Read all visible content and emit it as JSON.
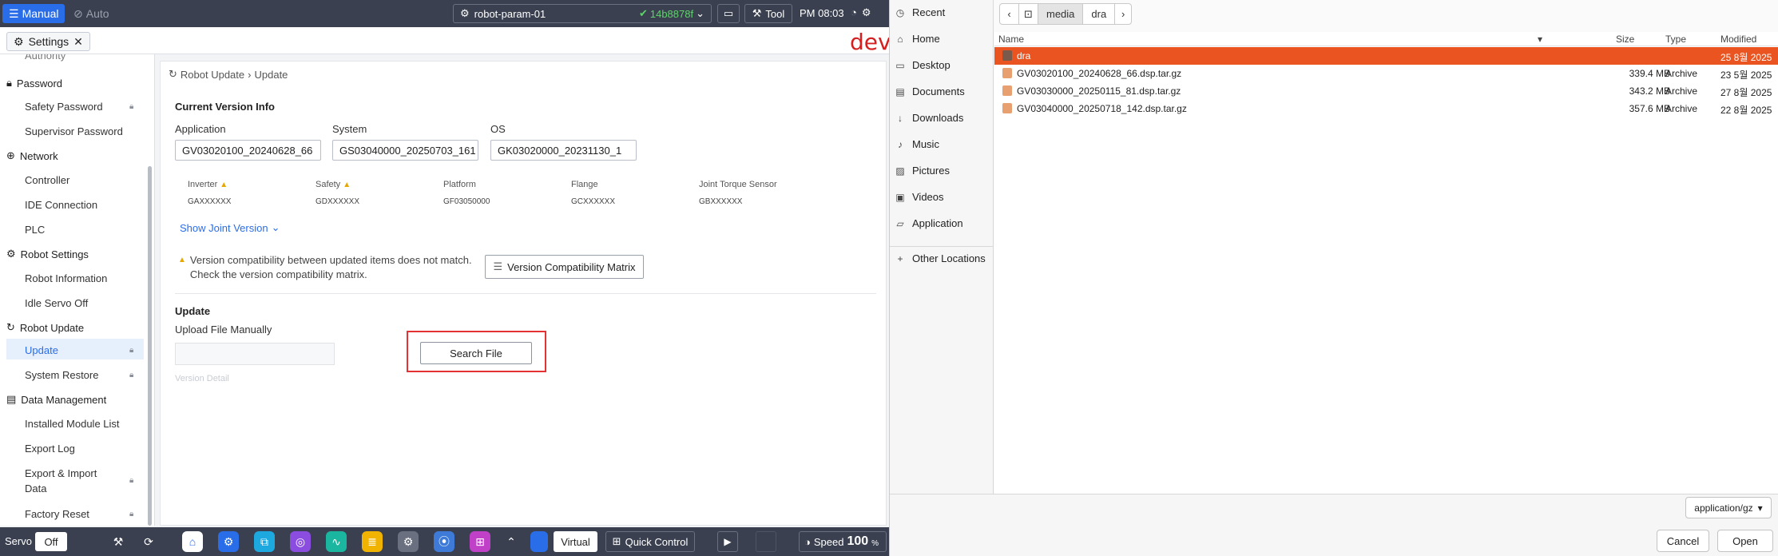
{
  "topbar": {
    "mode_manual": "Manual",
    "mode_auto": "Auto",
    "robot_name": "robot-param-01",
    "commit_hash": "14b8878f",
    "tool_label": "Tool",
    "clock": "PM 08:03"
  },
  "tabbar": {
    "settings_tab": "Settings",
    "dev_mark": "dev"
  },
  "sidebar": {
    "authority_partial": "Authority",
    "password": "Password",
    "safety_password": "Safety Password",
    "supervisor_password": "Supervisor Password",
    "network": "Network",
    "controller": "Controller",
    "ide_connection": "IDE Connection",
    "plc": "PLC",
    "robot_settings": "Robot Settings",
    "robot_information": "Robot Information",
    "idle_servo_off": "Idle Servo Off",
    "robot_update": "Robot Update",
    "update": "Update",
    "system_restore": "System Restore",
    "data_management": "Data Management",
    "installed_module_list": "Installed Module List",
    "export_log": "Export Log",
    "export_import_1": "Export & Import",
    "export_import_2": "Data",
    "factory_reset": "Factory Reset"
  },
  "content": {
    "breadcrumb_parent": "Robot Update",
    "breadcrumb_current": "Update",
    "current_version_title": "Current Version Info",
    "application_label": "Application",
    "application_value": "GV03020100_20240628_66",
    "system_label": "System",
    "system_value": "GS03040000_20250703_161",
    "os_label": "OS",
    "os_value": "GK03020000_20231130_1",
    "components": [
      {
        "label": "Inverter",
        "value": "GAXXXXXX"
      },
      {
        "label": "Safety",
        "value": "GDXXXXXX"
      },
      {
        "label": "Platform",
        "value": "GF03050000"
      },
      {
        "label": "Flange",
        "value": "GCXXXXXX"
      },
      {
        "label": "Joint Torque Sensor",
        "value": "GBXXXXXX"
      }
    ],
    "show_joint_version": "Show Joint Version",
    "compat_msg_line1": "Version compatibility between updated items does not match.",
    "compat_msg_line2": "Check the version compatibility matrix.",
    "compat_button": "Version Compatibility Matrix",
    "update_title": "Update",
    "upload_label": "Upload File Manually",
    "search_file": "Search File",
    "version_detail": "Version Detail"
  },
  "bottombar": {
    "servo_label": "Servo",
    "servo_state": "Off",
    "virtual": "Virtual",
    "quick_control": "Quick Control",
    "speed_label": "Speed",
    "speed_value": "100",
    "speed_unit": "%"
  },
  "chooser": {
    "places": [
      "Recent",
      "Home",
      "Desktop",
      "Documents",
      "Downloads",
      "Music",
      "Pictures",
      "Videos",
      "Application"
    ],
    "other_locations": "Other Locations",
    "path": [
      "media",
      "dra"
    ],
    "columns": {
      "name": "Name",
      "size": "Size",
      "type": "Type",
      "modified": "Modified"
    },
    "files": [
      {
        "name": "dra",
        "size": "",
        "type": "",
        "modified": "25  8월 2025"
      },
      {
        "name": "GV03020100_20240628_66.dsp.tar.gz",
        "size": "339.4 MB",
        "type": "Archive",
        "modified": "23  5월 2025"
      },
      {
        "name": "GV03030000_20250115_81.dsp.tar.gz",
        "size": "343.2 MB",
        "type": "Archive",
        "modified": "27  8월 2025"
      },
      {
        "name": "GV03040000_20250718_142.dsp.tar.gz",
        "size": "357.6 MB",
        "type": "Archive",
        "modified": "22  8월 2025"
      }
    ],
    "filter": "application/gz",
    "cancel": "Cancel",
    "open": "Open"
  },
  "colors": {
    "accent": "#2a6de8",
    "topbar_bg": "#3a4050",
    "selected_row": "#e95420",
    "highlight_box": "#e53232"
  }
}
